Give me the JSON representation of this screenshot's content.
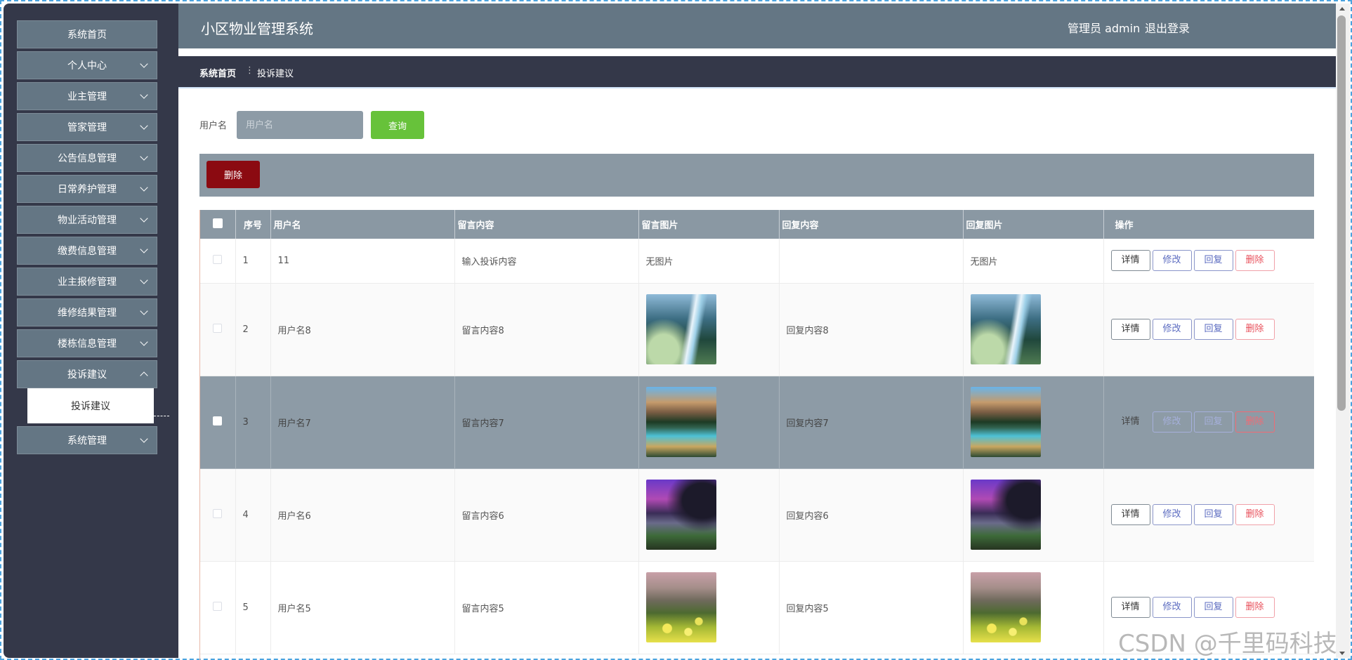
{
  "header": {
    "title": "小区物业管理系统",
    "user": "管理员 admin",
    "logout": "退出登录"
  },
  "sidebar": {
    "items": [
      {
        "label": "系统首页",
        "has_arrow": false
      },
      {
        "label": "个人中心",
        "has_arrow": true
      },
      {
        "label": "业主管理",
        "has_arrow": true
      },
      {
        "label": "管家管理",
        "has_arrow": true
      },
      {
        "label": "公告信息管理",
        "has_arrow": true
      },
      {
        "label": "日常养护管理",
        "has_arrow": true
      },
      {
        "label": "物业活动管理",
        "has_arrow": true
      },
      {
        "label": "缴费信息管理",
        "has_arrow": true
      },
      {
        "label": "业主报修管理",
        "has_arrow": true
      },
      {
        "label": "维修结果管理",
        "has_arrow": true
      },
      {
        "label": "楼栋信息管理",
        "has_arrow": true
      },
      {
        "label": "投诉建议",
        "has_arrow": true,
        "expanded": true
      },
      {
        "label": "系统管理",
        "has_arrow": true
      }
    ],
    "submenu": {
      "label": "投诉建议"
    }
  },
  "breadcrumb": {
    "home": "系统首页",
    "separator": "⋮",
    "current": "投诉建议"
  },
  "search": {
    "label": "用户名",
    "placeholder": "用户名",
    "button": "查询"
  },
  "toolbar": {
    "delete": "删除"
  },
  "table": {
    "columns": [
      "序号",
      "用户名",
      "留言内容",
      "留言图片",
      "回复内容",
      "回复图片",
      "操作"
    ],
    "actions": {
      "detail": "详情",
      "edit": "修改",
      "reply": "回复",
      "delete": "删除"
    },
    "rows": [
      {
        "index": "1",
        "username": "11",
        "content": "输入投诉内容",
        "image": "无图片",
        "reply": "",
        "reply_image": "无图片"
      },
      {
        "index": "2",
        "username": "用户名8",
        "content": "留言内容8",
        "image": "waterfall",
        "reply": "回复内容8",
        "reply_image": "waterfall"
      },
      {
        "index": "3",
        "username": "用户名7",
        "content": "留言内容7",
        "image": "lake",
        "reply": "回复内容7",
        "reply_image": "lake"
      },
      {
        "index": "4",
        "username": "用户名6",
        "content": "留言内容6",
        "image": "purple",
        "reply": "回复内容6",
        "reply_image": "purple"
      },
      {
        "index": "5",
        "username": "用户名5",
        "content": "留言内容5",
        "image": "flowers",
        "reply": "回复内容5",
        "reply_image": "flowers"
      }
    ]
  },
  "watermark": "CSDN @千里码科技",
  "colors": {
    "sidebar_bg": "#343849",
    "header_bg": "#647684",
    "menu_item_bg": "#647684",
    "search_button": "#67c23a",
    "delete_button": "#8b0a11",
    "table_header": "#8a98a3"
  }
}
